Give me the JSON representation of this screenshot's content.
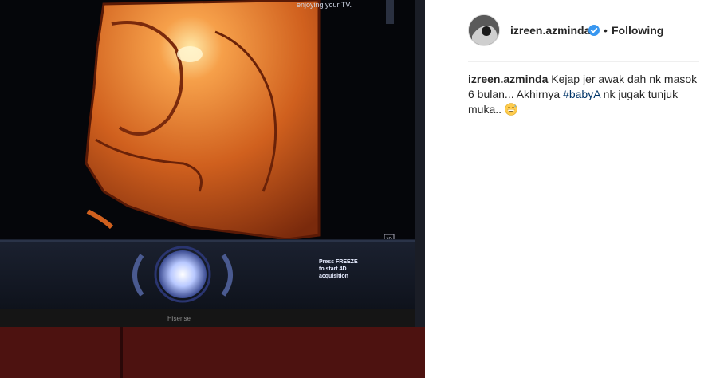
{
  "post": {
    "username": "izreen.azminda",
    "separator": "•",
    "follow_status": "Following",
    "caption": {
      "username": "izreen.azminda",
      "text_before": " Kejap jer awak dah nk masok 6 bulan... Akhirnya ",
      "hashtag": "#babyA",
      "text_after": " nk jugak tunjuk muka.. ",
      "emoji": "grinning-sweat-emoji"
    }
  },
  "media": {
    "tv_top_text": "enjoying your TV.",
    "freeze_line1": "Press FREEZE",
    "freeze_line2": "to start 4D",
    "freeze_line3": "acquisition",
    "small_badge": "3D",
    "brand": "Hisense"
  },
  "colors": {
    "verified": "#3897f0",
    "hashtag": "#003569",
    "text": "#262626"
  }
}
